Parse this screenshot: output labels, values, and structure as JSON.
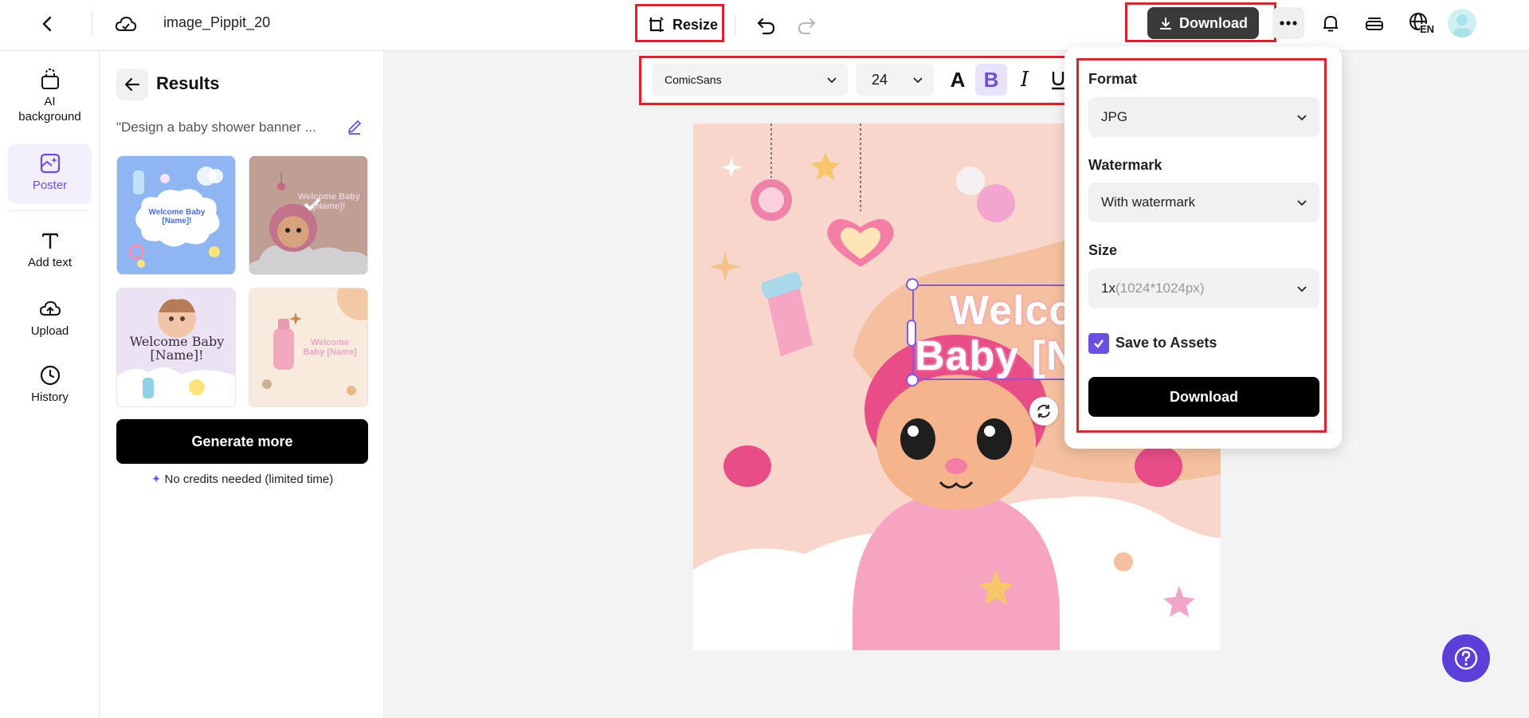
{
  "header": {
    "file_name": "image_Pippit_20",
    "resize_label": "Resize",
    "download_label": "Download",
    "language": "EN"
  },
  "rail": {
    "items": [
      {
        "label": "AI background",
        "icon": "ai-background-icon"
      },
      {
        "label": "Poster",
        "icon": "poster-icon",
        "active": true
      },
      {
        "label": "Add text",
        "icon": "text-icon"
      },
      {
        "label": "Upload",
        "icon": "upload-icon"
      },
      {
        "label": "History",
        "icon": "history-icon"
      }
    ]
  },
  "results": {
    "title": "Results",
    "prompt": "\"Design a baby shower banner ...",
    "thumbnails": [
      {
        "text": "Welcome Baby [Name]!",
        "bg": "#8fb5f2"
      },
      {
        "text": "Welcome Baby [Name]!",
        "bg": "#c9a79c",
        "selected": true
      },
      {
        "text": "Welcome Baby [Name]!",
        "bg": "#e9e2f4"
      },
      {
        "text": "Welcome Baby [Name]",
        "bg": "#f7e8da"
      }
    ],
    "generate_label": "Generate more",
    "credits_note": "No credits needed (limited time)"
  },
  "text_toolbar": {
    "font": "ComicSans",
    "size": "24",
    "color_glyph": "A",
    "bold_glyph": "B",
    "italic_glyph": "I"
  },
  "canvas": {
    "headline_line1": "Welco",
    "headline_line2": "Baby [N"
  },
  "download_panel": {
    "format_label": "Format",
    "format_value": "JPG",
    "watermark_label": "Watermark",
    "watermark_value": "With watermark",
    "size_label": "Size",
    "size_value": "1x",
    "size_detail": "(1024*1024px)",
    "save_label": "Save to Assets",
    "save_checked": true,
    "download_label": "Download"
  },
  "colors": {
    "accent": "#6b4fe0",
    "highlight": "#e0202e",
    "canvas_bg": "#f9d6cc"
  }
}
